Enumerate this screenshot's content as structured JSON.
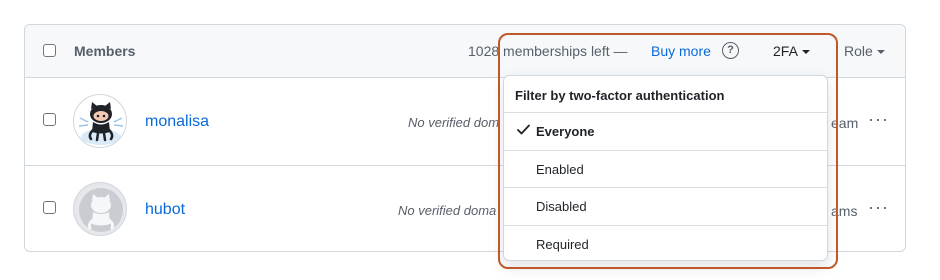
{
  "header": {
    "title": "Members",
    "count_text": "1028 memberships left —",
    "buy_more": "Buy more",
    "help_glyph": "?",
    "twofa_label": "2FA",
    "role_label": "Role"
  },
  "members": [
    {
      "username": "monalisa",
      "verified": "No verified dom",
      "teams": "eam"
    },
    {
      "username": "hubot",
      "verified": "No verified doma",
      "teams": "ams"
    }
  ],
  "kebab_glyph": "···",
  "dropdown": {
    "title": "Filter by two-factor authentication",
    "options": [
      {
        "label": "Everyone",
        "selected": true
      },
      {
        "label": "Enabled",
        "selected": false
      },
      {
        "label": "Disabled",
        "selected": false
      },
      {
        "label": "Required",
        "selected": false
      }
    ]
  },
  "colors": {
    "link": "#0969da",
    "highlight": "#c0592a",
    "border": "#d0d7de",
    "header_bg": "#f6f8fa"
  },
  "icons": {
    "monalisa_avatar": "octocat-icon",
    "hubot_avatar": "hubot-icon",
    "help": "question-circle-icon",
    "check": "check-icon"
  }
}
